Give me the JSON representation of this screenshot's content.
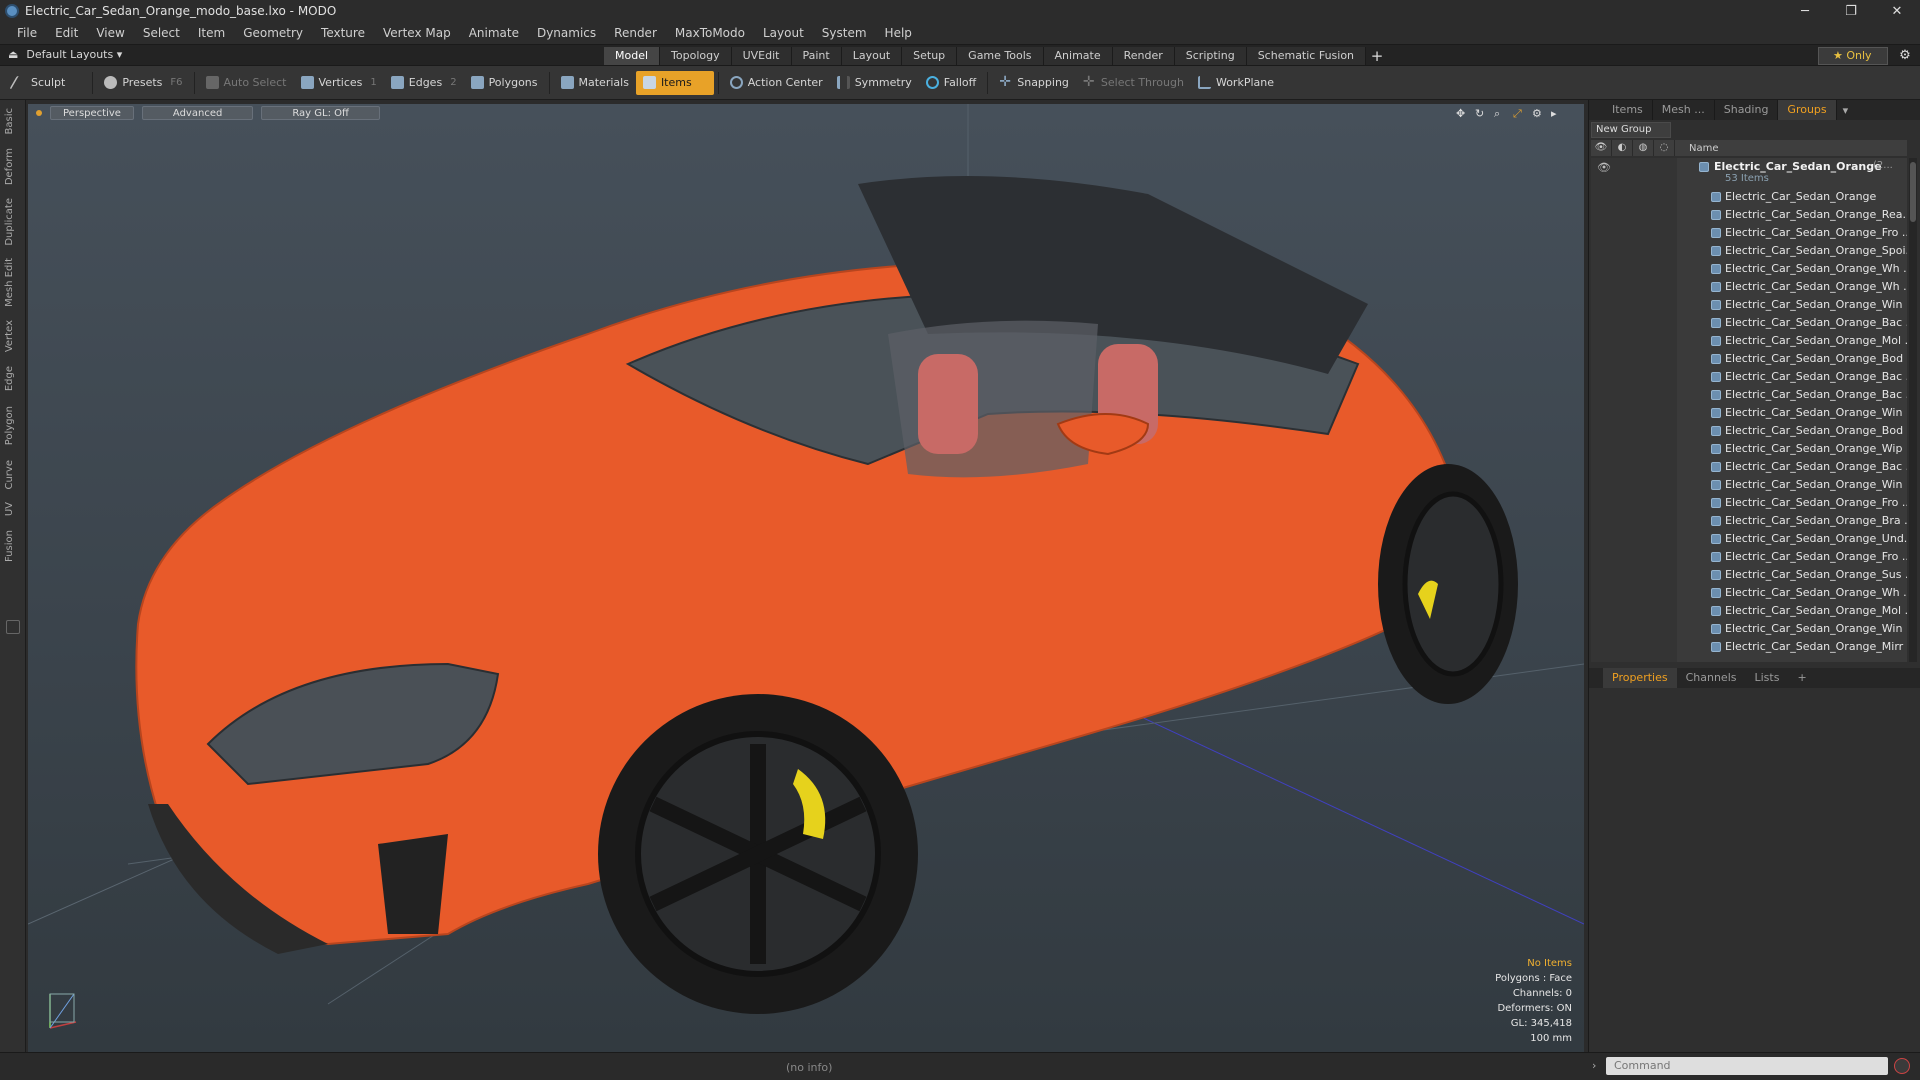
{
  "window": {
    "title": "Electric_Car_Sedan_Orange_modo_base.lxo - MODO",
    "controls": [
      "─",
      "❐",
      "✕"
    ]
  },
  "menu": [
    "File",
    "Edit",
    "View",
    "Select",
    "Item",
    "Geometry",
    "Texture",
    "Vertex Map",
    "Animate",
    "Dynamics",
    "Render",
    "MaxToModo",
    "Layout",
    "System",
    "Help"
  ],
  "layout_selector": "Default Layouts",
  "tabs": [
    "Model",
    "Topology",
    "UVEdit",
    "Paint",
    "Layout",
    "Setup",
    "Game Tools",
    "Animate",
    "Render",
    "Scripting",
    "Schematic Fusion"
  ],
  "active_tab": "Model",
  "only_label": "Only",
  "toolbar": {
    "sculpt": "Sculpt",
    "presets": "Presets",
    "presets_key": "F6",
    "auto_select": "Auto Select",
    "vertices": "Vertices",
    "vertices_count": "1",
    "edges": "Edges",
    "edges_count": "2",
    "polygons": "Polygons",
    "materials": "Materials",
    "items": "Items",
    "action_center": "Action Center",
    "symmetry": "Symmetry",
    "falloff": "Falloff",
    "snapping": "Snapping",
    "select_through": "Select Through",
    "workplane": "WorkPlane"
  },
  "left_tabs": [
    "Basic",
    "Deform",
    "Duplicate",
    "Mesh Edit",
    "Vertex",
    "Edge",
    "Polygon",
    "Curve",
    "UV",
    "Fusion"
  ],
  "viewport": {
    "view": "Perspective",
    "style": "Advanced",
    "raygl": "Ray GL: Off",
    "stats": {
      "no_items": "No Items",
      "polygons": "Polygons : Face",
      "channels": "Channels: 0",
      "deformers": "Deformers: ON",
      "gl": "GL: 345,418",
      "scale": "100 mm"
    },
    "colors": {
      "body": "#e85a2a",
      "caliper": "#e6d21c",
      "background": "#3e474f"
    }
  },
  "right_tabs": [
    "Items",
    "Mesh ...",
    "Shading",
    "Groups"
  ],
  "active_right_tab": "Groups",
  "new_group": "New Group",
  "list_header": "Name",
  "group": {
    "name": "Electric_Car_Sedan_Orange",
    "count_suffix": "(2...",
    "items_count": "53 Items",
    "items": [
      "Electric_Car_Sedan_Orange",
      "Electric_Car_Sedan_Orange_Rea...",
      "Electric_Car_Sedan_Orange_Fro ...",
      "Electric_Car_Sedan_Orange_Spoi...",
      "Electric_Car_Sedan_Orange_Wh ...",
      "Electric_Car_Sedan_Orange_Wh ...",
      "Electric_Car_Sedan_Orange_Win ...",
      "Electric_Car_Sedan_Orange_Bac ...",
      "Electric_Car_Sedan_Orange_Mol ...",
      "Electric_Car_Sedan_Orange_Bod ...",
      "Electric_Car_Sedan_Orange_Bac ...",
      "Electric_Car_Sedan_Orange_Bac ...",
      "Electric_Car_Sedan_Orange_Win ...",
      "Electric_Car_Sedan_Orange_Bod ...",
      "Electric_Car_Sedan_Orange_Wip ...",
      "Electric_Car_Sedan_Orange_Bac ...",
      "Electric_Car_Sedan_Orange_Win ...",
      "Electric_Car_Sedan_Orange_Fro ...",
      "Electric_Car_Sedan_Orange_Bra ...",
      "Electric_Car_Sedan_Orange_Und...",
      "Electric_Car_Sedan_Orange_Fro ...",
      "Electric_Car_Sedan_Orange_Sus ...",
      "Electric_Car_Sedan_Orange_Wh ...",
      "Electric_Car_Sedan_Orange_Mol ...",
      "Electric_Car_Sedan_Orange_Win ...",
      "Electric_Car_Sedan_Orange_Mirr ..."
    ]
  },
  "bottom_tabs": [
    "Properties",
    "Channels",
    "Lists"
  ],
  "active_bottom_tab": "Properties",
  "status": {
    "info": "(no info)",
    "command_placeholder": "Command"
  }
}
